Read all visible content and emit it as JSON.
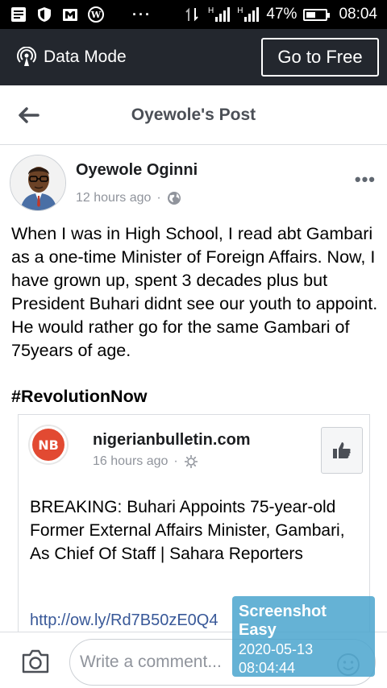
{
  "status_bar": {
    "battery": "47%",
    "time": "08:04",
    "signal_1": "H",
    "signal_2": "H",
    "battery_level": 0.47
  },
  "data_bar": {
    "label": "Data Mode",
    "button": "Go to Free"
  },
  "nav": {
    "title": "Oyewole's Post"
  },
  "post": {
    "author": "Oyewole Oginni",
    "time": "12 hours ago",
    "separator": "·",
    "text": "When I was in High School, I read abt Gambari as a one-time Minister of Foreign Affairs. Now, I have grown up, spent 3 decades plus but President Buhari didnt see our youth to appoint. He would rather go for the same Gambari of 75years of age.",
    "hashtag": "#RevolutionNow",
    "more": "•••"
  },
  "shared": {
    "logo": "NB",
    "page_name": "nigerianbulletin.com",
    "time": "16 hours ago",
    "separator": "·",
    "text": "BREAKING: Buhari Appoints 75-year-old Former External Affairs Minister, Gambari, As Chief Of Staff | Sahara Reporters",
    "link": "http://ow.ly/Rd7B50zE0Q4"
  },
  "comment": {
    "placeholder": "Write a comment..."
  },
  "watermark": {
    "title": "Screenshot Easy",
    "date": "2020-05-13",
    "time": "08:04:44"
  },
  "colors": {
    "status_bg": "#000000",
    "data_bar_bg": "#23272e",
    "link": "#385898",
    "nb_red": "#e24a32",
    "watermark": "#4aa4ce"
  }
}
